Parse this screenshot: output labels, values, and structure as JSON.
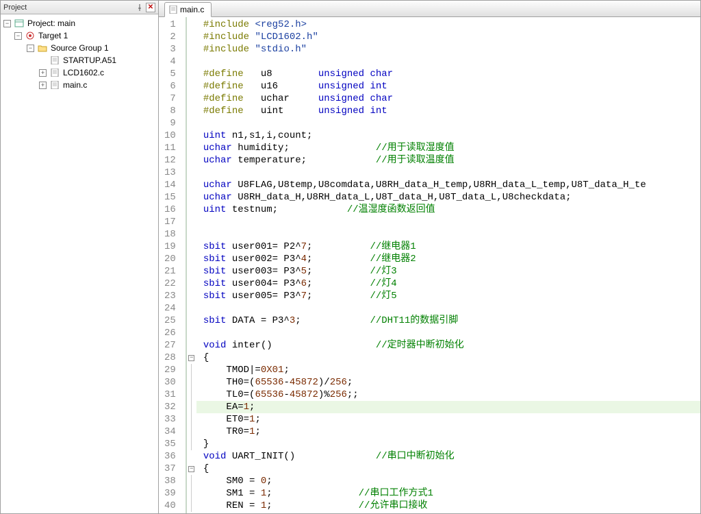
{
  "panel": {
    "title": "Project",
    "pin_icon": "pin-icon",
    "close_icon": "close-icon"
  },
  "tree": {
    "root": {
      "expander": "−",
      "label": "Project: main"
    },
    "target": {
      "expander": "−",
      "label": "Target 1"
    },
    "group": {
      "expander": "−",
      "label": "Source Group 1"
    },
    "files": [
      {
        "expander": "",
        "label": "STARTUP.A51"
      },
      {
        "expander": "+",
        "label": "LCD1602.c"
      },
      {
        "expander": "+",
        "label": "main.c"
      }
    ]
  },
  "editor": {
    "tab_label": "main.c"
  },
  "code": {
    "start_line": 1,
    "lines": [
      {
        "n": 1,
        "fold": "",
        "seg": [
          [
            "pp",
            "#include "
          ],
          [
            "inc",
            "<reg52.h>"
          ]
        ]
      },
      {
        "n": 2,
        "fold": "",
        "seg": [
          [
            "pp",
            "#include "
          ],
          [
            "inc",
            "\"LCD1602.h\""
          ]
        ]
      },
      {
        "n": 3,
        "fold": "",
        "seg": [
          [
            "pp",
            "#include "
          ],
          [
            "inc",
            "\"stdio.h\""
          ]
        ]
      },
      {
        "n": 4,
        "fold": "",
        "seg": [
          [
            "id",
            ""
          ]
        ]
      },
      {
        "n": 5,
        "fold": "",
        "seg": [
          [
            "pp",
            "#define   "
          ],
          [
            "id",
            "u8        "
          ],
          [
            "kw",
            "unsigned char"
          ]
        ]
      },
      {
        "n": 6,
        "fold": "",
        "seg": [
          [
            "pp",
            "#define   "
          ],
          [
            "id",
            "u16       "
          ],
          [
            "kw",
            "unsigned int"
          ]
        ]
      },
      {
        "n": 7,
        "fold": "",
        "seg": [
          [
            "pp",
            "#define   "
          ],
          [
            "id",
            "uchar     "
          ],
          [
            "kw",
            "unsigned char"
          ]
        ]
      },
      {
        "n": 8,
        "fold": "",
        "seg": [
          [
            "pp",
            "#define   "
          ],
          [
            "id",
            "uint      "
          ],
          [
            "kw",
            "unsigned int"
          ]
        ]
      },
      {
        "n": 9,
        "fold": "",
        "seg": [
          [
            "id",
            ""
          ]
        ]
      },
      {
        "n": 10,
        "fold": "",
        "seg": [
          [
            "kw",
            "uint"
          ],
          [
            "id",
            " n1,s1,i,count;"
          ]
        ]
      },
      {
        "n": 11,
        "fold": "",
        "seg": [
          [
            "kw",
            "uchar"
          ],
          [
            "id",
            " humidity;               "
          ],
          [
            "cmt",
            "//用于读取湿度值"
          ]
        ]
      },
      {
        "n": 12,
        "fold": "",
        "seg": [
          [
            "kw",
            "uchar"
          ],
          [
            "id",
            " temperature;            "
          ],
          [
            "cmt",
            "//用于读取温度值"
          ]
        ]
      },
      {
        "n": 13,
        "fold": "",
        "seg": [
          [
            "id",
            ""
          ]
        ]
      },
      {
        "n": 14,
        "fold": "",
        "seg": [
          [
            "kw",
            "uchar"
          ],
          [
            "id",
            " U8FLAG,U8temp,U8comdata,U8RH_data_H_temp,U8RH_data_L_temp,U8T_data_H_te"
          ]
        ]
      },
      {
        "n": 15,
        "fold": "",
        "seg": [
          [
            "kw",
            "uchar"
          ],
          [
            "id",
            " U8RH_data_H,U8RH_data_L,U8T_data_H,U8T_data_L,U8checkdata;"
          ]
        ]
      },
      {
        "n": 16,
        "fold": "",
        "seg": [
          [
            "kw",
            "uint"
          ],
          [
            "id",
            " testnum;            "
          ],
          [
            "cmt",
            "//温湿度函数返回值"
          ]
        ]
      },
      {
        "n": 17,
        "fold": "",
        "seg": [
          [
            "id",
            ""
          ]
        ]
      },
      {
        "n": 18,
        "fold": "",
        "seg": [
          [
            "id",
            ""
          ]
        ]
      },
      {
        "n": 19,
        "fold": "",
        "seg": [
          [
            "kw",
            "sbit"
          ],
          [
            "id",
            " user001= P2^"
          ],
          [
            "num",
            "7"
          ],
          [
            "id",
            ";          "
          ],
          [
            "cmt",
            "//继电器1"
          ]
        ]
      },
      {
        "n": 20,
        "fold": "",
        "seg": [
          [
            "kw",
            "sbit"
          ],
          [
            "id",
            " user002= P3^"
          ],
          [
            "num",
            "4"
          ],
          [
            "id",
            ";          "
          ],
          [
            "cmt",
            "//继电器2"
          ]
        ]
      },
      {
        "n": 21,
        "fold": "",
        "seg": [
          [
            "kw",
            "sbit"
          ],
          [
            "id",
            " user003= P3^"
          ],
          [
            "num",
            "5"
          ],
          [
            "id",
            ";          "
          ],
          [
            "cmt",
            "//灯3"
          ]
        ]
      },
      {
        "n": 22,
        "fold": "",
        "seg": [
          [
            "kw",
            "sbit"
          ],
          [
            "id",
            " user004= P3^"
          ],
          [
            "num",
            "6"
          ],
          [
            "id",
            ";          "
          ],
          [
            "cmt",
            "//灯4"
          ]
        ]
      },
      {
        "n": 23,
        "fold": "",
        "seg": [
          [
            "kw",
            "sbit"
          ],
          [
            "id",
            " user005= P3^"
          ],
          [
            "num",
            "7"
          ],
          [
            "id",
            ";          "
          ],
          [
            "cmt",
            "//灯5"
          ]
        ]
      },
      {
        "n": 24,
        "fold": "",
        "seg": [
          [
            "id",
            ""
          ]
        ]
      },
      {
        "n": 25,
        "fold": "",
        "seg": [
          [
            "kw",
            "sbit"
          ],
          [
            "id",
            " DATA = P3^"
          ],
          [
            "num",
            "3"
          ],
          [
            "id",
            ";            "
          ],
          [
            "cmt",
            "//DHT11的数据引脚"
          ]
        ]
      },
      {
        "n": 26,
        "fold": "",
        "seg": [
          [
            "id",
            ""
          ]
        ]
      },
      {
        "n": 27,
        "fold": "",
        "seg": [
          [
            "kw",
            "void"
          ],
          [
            "id",
            " inter()                  "
          ],
          [
            "cmt",
            "//定时器中断初始化"
          ]
        ]
      },
      {
        "n": 28,
        "fold": "box",
        "seg": [
          [
            "id",
            "{"
          ]
        ]
      },
      {
        "n": 29,
        "fold": "bar",
        "seg": [
          [
            "id",
            "    TMOD|="
          ],
          [
            "num",
            "0X01"
          ],
          [
            "id",
            ";"
          ]
        ]
      },
      {
        "n": 30,
        "fold": "bar",
        "seg": [
          [
            "id",
            "    TH0=("
          ],
          [
            "num",
            "65536"
          ],
          [
            "id",
            "-"
          ],
          [
            "num",
            "45872"
          ],
          [
            "id",
            ")/"
          ],
          [
            "num",
            "256"
          ],
          [
            "id",
            ";"
          ]
        ]
      },
      {
        "n": 31,
        "fold": "bar",
        "seg": [
          [
            "id",
            "    TL0=("
          ],
          [
            "num",
            "65536"
          ],
          [
            "id",
            "-"
          ],
          [
            "num",
            "45872"
          ],
          [
            "id",
            ")%"
          ],
          [
            "num",
            "256"
          ],
          [
            "id",
            ";;"
          ]
        ]
      },
      {
        "n": 32,
        "fold": "bar",
        "hl": true,
        "seg": [
          [
            "id",
            "    EA="
          ],
          [
            "num",
            "1"
          ],
          [
            "id",
            ";"
          ]
        ]
      },
      {
        "n": 33,
        "fold": "bar",
        "seg": [
          [
            "id",
            "    ET0="
          ],
          [
            "num",
            "1"
          ],
          [
            "id",
            ";"
          ]
        ]
      },
      {
        "n": 34,
        "fold": "bar",
        "seg": [
          [
            "id",
            "    TR0="
          ],
          [
            "num",
            "1"
          ],
          [
            "id",
            ";"
          ]
        ]
      },
      {
        "n": 35,
        "fold": "end",
        "seg": [
          [
            "id",
            "}"
          ]
        ]
      },
      {
        "n": 36,
        "fold": "",
        "seg": [
          [
            "kw",
            "void"
          ],
          [
            "id",
            " UART_INIT()              "
          ],
          [
            "cmt",
            "//串口中断初始化"
          ]
        ]
      },
      {
        "n": 37,
        "fold": "box",
        "seg": [
          [
            "id",
            "{"
          ]
        ]
      },
      {
        "n": 38,
        "fold": "bar",
        "seg": [
          [
            "id",
            "    SM0 = "
          ],
          [
            "num",
            "0"
          ],
          [
            "id",
            ";"
          ]
        ]
      },
      {
        "n": 39,
        "fold": "bar",
        "seg": [
          [
            "id",
            "    SM1 = "
          ],
          [
            "num",
            "1"
          ],
          [
            "id",
            ";               "
          ],
          [
            "cmt",
            "//串口工作方式1"
          ]
        ]
      },
      {
        "n": 40,
        "fold": "bar",
        "seg": [
          [
            "id",
            "    REN = "
          ],
          [
            "num",
            "1"
          ],
          [
            "id",
            ";               "
          ],
          [
            "cmt",
            "//允许串口接收"
          ]
        ]
      }
    ]
  }
}
